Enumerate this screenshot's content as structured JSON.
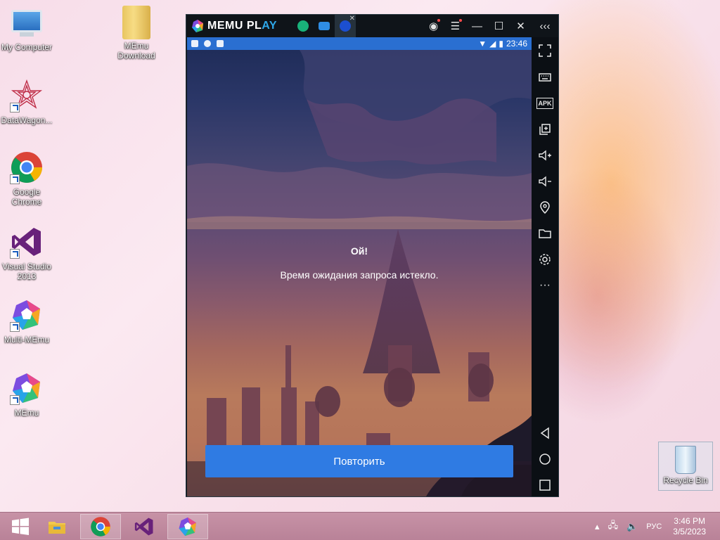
{
  "desktop": {
    "icons": [
      {
        "label": "My Computer"
      },
      {
        "label": "MEmu\nDownload"
      },
      {
        "label": "DataWagon..."
      },
      {
        "label": "Google\nChrome"
      },
      {
        "label": "Visual Studio\n2013"
      },
      {
        "label": "Multi-MEmu"
      },
      {
        "label": "MEmu"
      },
      {
        "label": "Recycle Bin"
      }
    ]
  },
  "emulator": {
    "logo_main": "MEMU PL",
    "logo_accent": "AY",
    "titlebar_icons": [
      "account-icon",
      "menu-icon",
      "minimize-icon",
      "maximize-icon",
      "close-icon",
      "collapse-sidebar-icon"
    ],
    "tabs": [
      {
        "name": "app-tab",
        "color": "#19b27a"
      },
      {
        "name": "files-tab",
        "color": "#2f8de4"
      },
      {
        "name": "memu-tab",
        "color": "#1c4fd0"
      }
    ],
    "status_time": "23:46",
    "sidebar": [
      "fullscreen-icon",
      "keyboard-icon",
      "apk-icon",
      "multi-window-icon",
      "volume-up-icon",
      "volume-down-icon",
      "location-icon",
      "folder-icon",
      "settings-icon",
      "more-icon",
      "back-icon",
      "home-icon",
      "recents-icon"
    ],
    "apk_label": "APK",
    "dialog": {
      "title": "Ой!",
      "message": "Время ожидания запроса истекло.",
      "retry_label": "Повторить"
    }
  },
  "taskbar": {
    "items": [
      "start-button",
      "file-explorer",
      "chrome",
      "visual-studio",
      "memu"
    ],
    "language": "РУС",
    "time": "3:46 PM",
    "date": "3/5/2023",
    "accent": "#b98298"
  }
}
